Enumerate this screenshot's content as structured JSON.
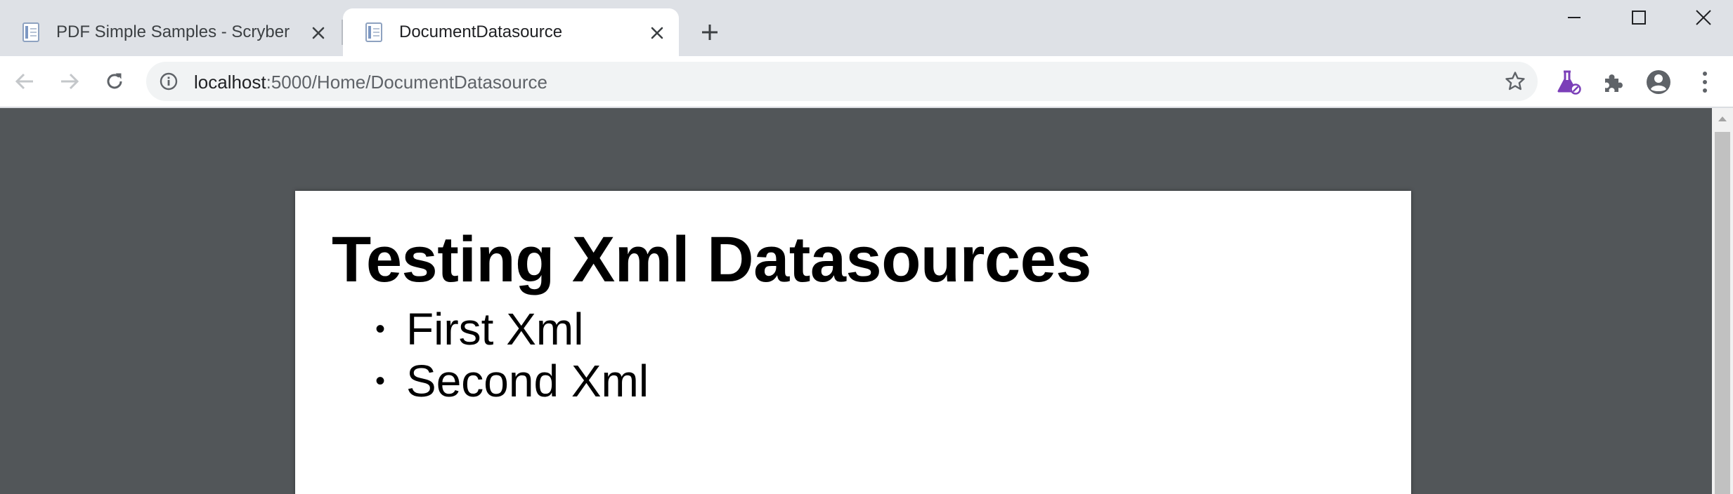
{
  "tabs": [
    {
      "title": "PDF Simple Samples - Scryber",
      "active": false
    },
    {
      "title": "DocumentDatasource",
      "active": true
    }
  ],
  "address_bar": {
    "host": "localhost",
    "path": ":5000/Home/DocumentDatasource"
  },
  "document": {
    "heading": "Testing Xml Datasources",
    "items": [
      "First Xml",
      "Second Xml"
    ],
    "bullet": "•"
  },
  "colors": {
    "tabstrip": "#dee1e6",
    "viewer_background": "#525659",
    "page": "#ffffff",
    "labs_icon": "#7b3fb8"
  },
  "icons": {
    "tab_favicon": "document-favicon-icon",
    "close": "close-icon",
    "new_tab": "plus-icon",
    "back": "arrow-left-icon",
    "forward": "arrow-right-icon",
    "reload": "reload-icon",
    "info": "info-icon",
    "bookmark": "star-icon",
    "labs": "flask-icon",
    "extensions": "puzzle-icon",
    "profile": "account-circle-icon",
    "menu": "kebab-menu-icon"
  }
}
